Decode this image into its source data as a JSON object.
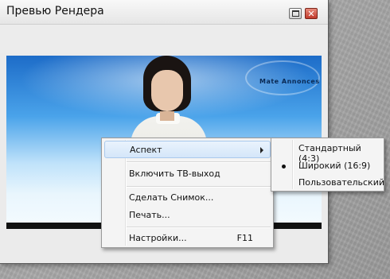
{
  "window": {
    "title": "Превью Рендера",
    "restore_icon": "restore-icon",
    "close_icon": "close-icon",
    "close_color": "#c0392b"
  },
  "preview": {
    "overlay_text": "Mate Annonces",
    "accent_color": "#4aa3ea"
  },
  "context_menu": {
    "aspect": "Аспект",
    "tv_out": "Включить ТВ-выход",
    "snapshot": "Сделать Снимок...",
    "print": "Печать...",
    "settings": "Настройки...",
    "settings_shortcut": "F11"
  },
  "aspect_submenu": {
    "standard": "Стандартный  (4:3)",
    "wide": "Широкий (16:9)",
    "custom": "Пользовательский",
    "selected": "wide"
  }
}
